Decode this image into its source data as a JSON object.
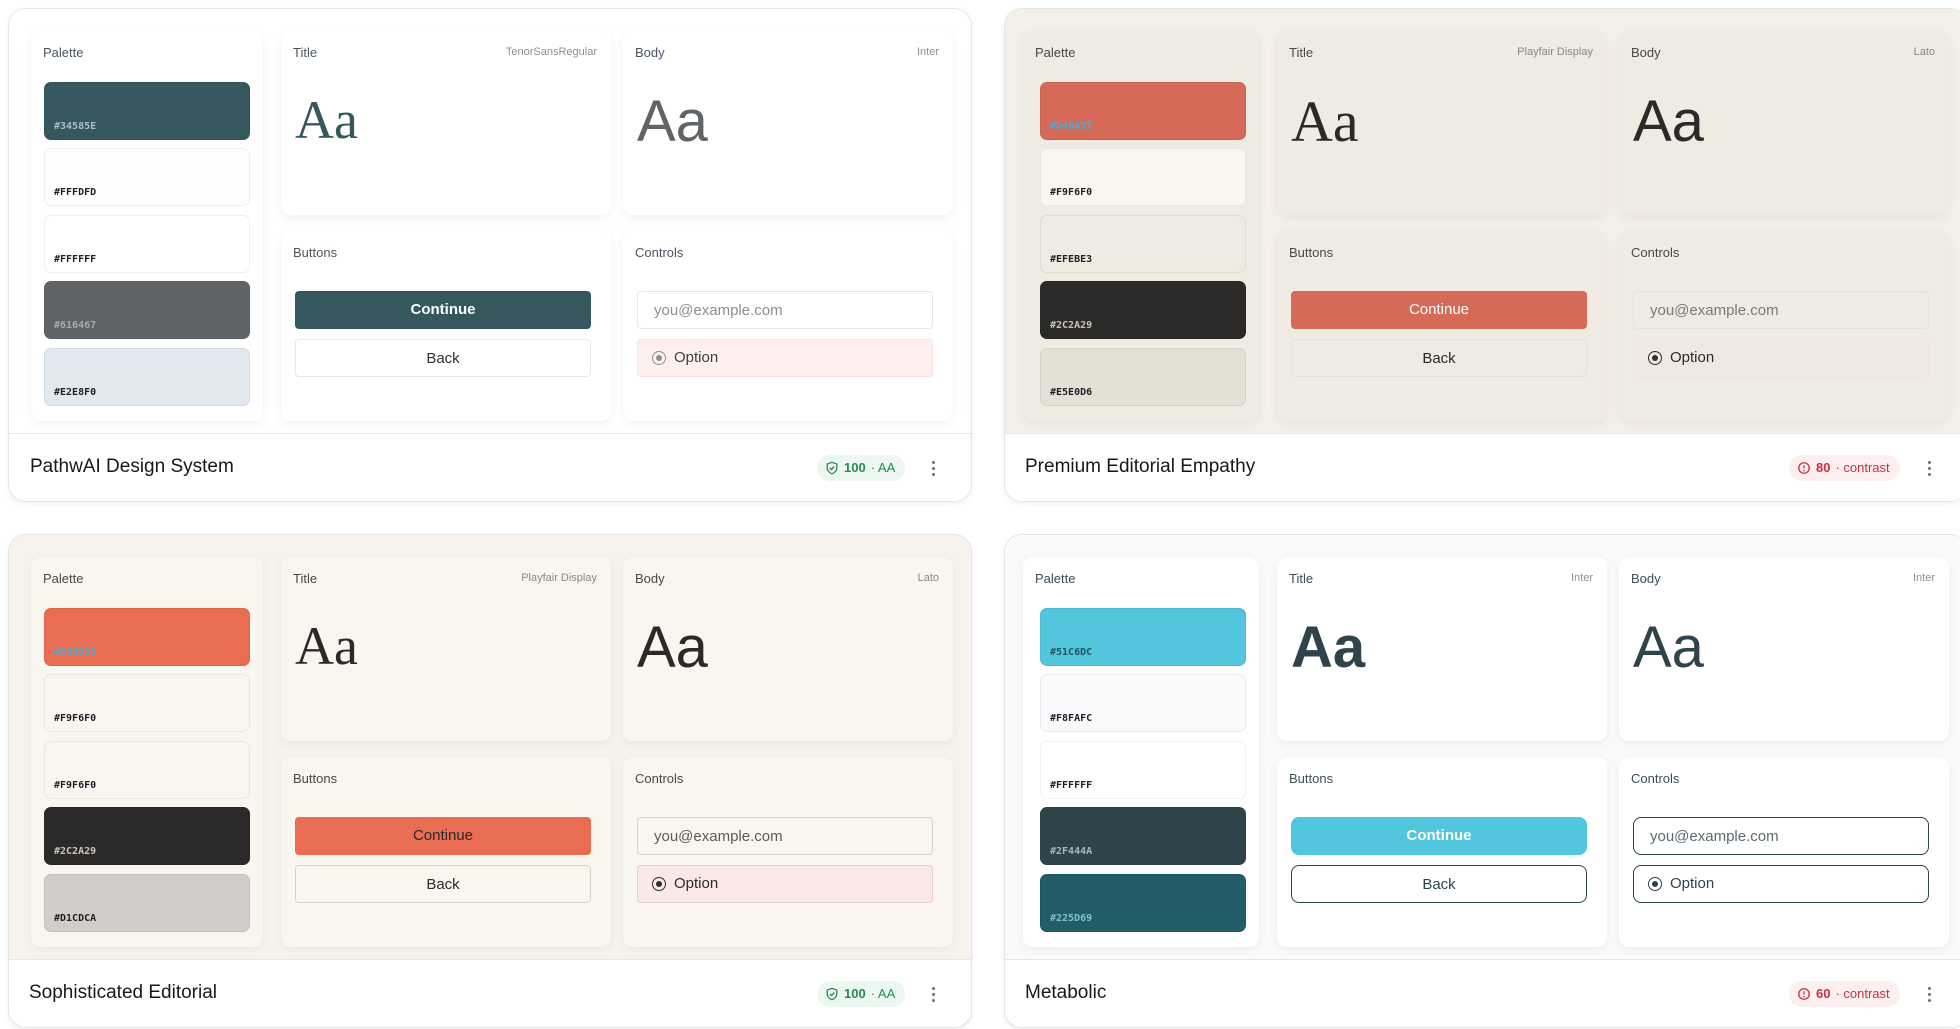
{
  "common": {
    "palette_label": "Palette",
    "title_label": "Title",
    "body_label": "Body",
    "buttons_label": "Buttons",
    "controls_label": "Controls",
    "sample_text": "Aa",
    "primary_button": "Continue",
    "secondary_button": "Back",
    "input_placeholder": "you@example.com",
    "radio_option": "Option"
  },
  "cards": [
    {
      "name": "PathwAI Design System",
      "title_font": "TenorSansRegular",
      "body_font": "Inter",
      "score": "100",
      "score_suffix": "· AA",
      "status": "ok",
      "swatches": [
        "#34585E",
        "#FFFDFD",
        "#FFFFFF",
        "#616467",
        "#E2E8F0"
      ]
    },
    {
      "name": "Premium Editorial Empathy",
      "title_font": "Playfair Display",
      "body_font": "Lato",
      "score": "80",
      "score_suffix": "· contrast",
      "status": "warn",
      "swatches": [
        "#D46A57",
        "#F9F6F0",
        "#EFEBE3",
        "#2C2A29",
        "#E5E0D6"
      ]
    },
    {
      "name": "Sophisticated Editorial",
      "title_font": "Playfair Display",
      "body_font": "Lato",
      "score": "100",
      "score_suffix": "· AA",
      "status": "ok",
      "swatches": [
        "#E86D53",
        "#F9F6F0",
        "#F9F6F0",
        "#2C2A29",
        "#D1CDCA"
      ]
    },
    {
      "name": "Metabolic",
      "title_font": "Inter",
      "body_font": "Inter",
      "score": "60",
      "score_suffix": "· contrast",
      "status": "warn",
      "swatches": [
        "#51C6DC",
        "#F8FAFC",
        "#FFFFFF",
        "#2F444A",
        "#225D69"
      ]
    }
  ]
}
